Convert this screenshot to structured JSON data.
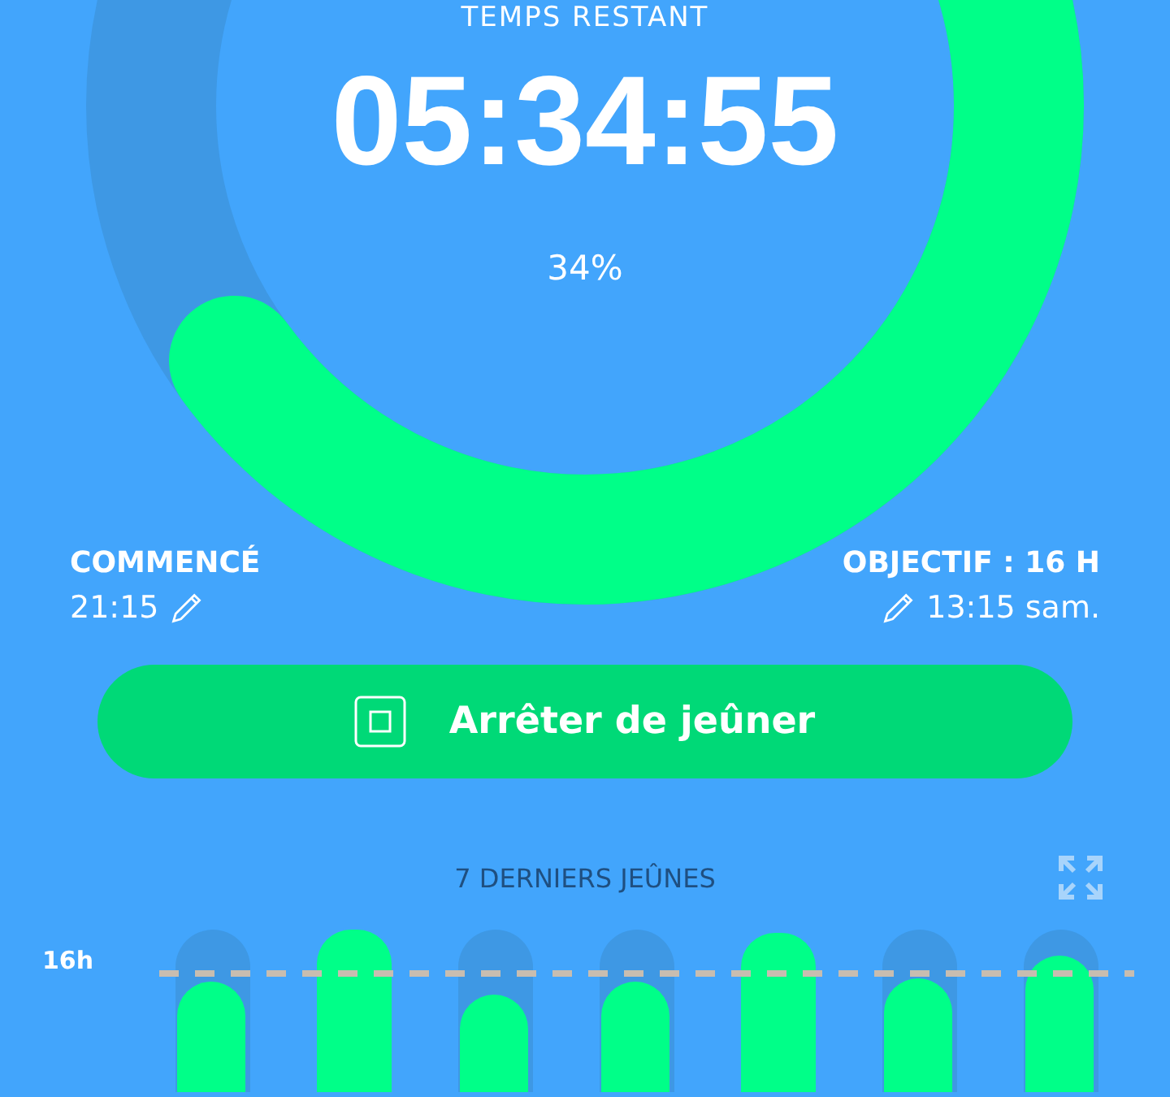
{
  "timer": {
    "label": "TEMPS RESTANT",
    "remaining": "05:34:55",
    "percent": "34%"
  },
  "started": {
    "label": "COMMENCÉ",
    "time": "21:15"
  },
  "goal": {
    "label": "OBJECTIF : 16 H",
    "time": "13:15 sam."
  },
  "stop_button": {
    "label": "Arrêter de jeûner"
  },
  "history": {
    "title": "7 DERNIERS JEÛNES",
    "goal_label": "16h"
  }
}
